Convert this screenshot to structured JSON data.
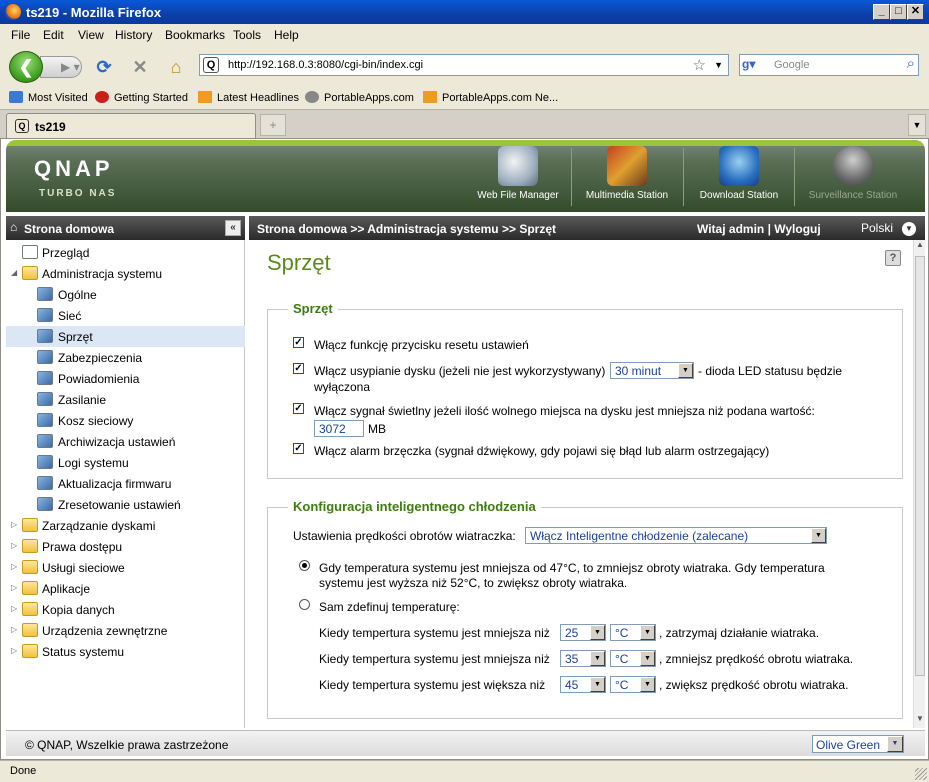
{
  "window": {
    "title": "ts219 - Mozilla Firefox"
  },
  "menu": [
    "File",
    "Edit",
    "View",
    "History",
    "Bookmarks",
    "Tools",
    "Help"
  ],
  "nav": {
    "url": "http://192.168.0.3:8080/cgi-bin/index.cgi",
    "search_placeholder": "Google"
  },
  "bookmarks": [
    "Most Visited",
    "Getting Started",
    "Latest Headlines",
    "PortableApps.com",
    "PortableApps.com Ne..."
  ],
  "tabs": {
    "active": "ts219",
    "new_tab_glyph": "+"
  },
  "header": {
    "logo": "QNAP",
    "sublogo": "TURBO NAS",
    "apps": [
      {
        "label": "Web File Manager"
      },
      {
        "label": "Multimedia Station"
      },
      {
        "label": "Download Station"
      },
      {
        "label": "Surveillance Station"
      }
    ]
  },
  "leftbar": {
    "title": "Strona domowa",
    "collapse": "«"
  },
  "rightbar": {
    "breadcrumb": "Strona domowa >> Administracja systemu >> Sprzęt",
    "welcome": "Witaj admin | Wyloguj",
    "language": "Polski"
  },
  "sidebar": {
    "items": [
      {
        "label": "Przegląd",
        "level": 0,
        "type": "page"
      },
      {
        "label": "Administracja systemu",
        "level": 0,
        "type": "folder",
        "expanded": true
      },
      {
        "label": "Ogólne",
        "level": 1
      },
      {
        "label": "Sieć",
        "level": 1
      },
      {
        "label": "Sprzęt",
        "level": 1,
        "selected": true
      },
      {
        "label": "Zabezpieczenia",
        "level": 1
      },
      {
        "label": "Powiadomienia",
        "level": 1
      },
      {
        "label": "Zasilanie",
        "level": 1
      },
      {
        "label": "Kosz sieciowy",
        "level": 1
      },
      {
        "label": "Archiwizacja ustawień",
        "level": 1
      },
      {
        "label": "Logi systemu",
        "level": 1
      },
      {
        "label": "Aktualizacja firmwaru",
        "level": 1
      },
      {
        "label": "Zresetowanie ustawień",
        "level": 1
      },
      {
        "label": "Zarządzanie dyskami",
        "level": 0,
        "type": "folder"
      },
      {
        "label": "Prawa dostępu",
        "level": 0,
        "type": "folder"
      },
      {
        "label": "Usługi sieciowe",
        "level": 0,
        "type": "folder"
      },
      {
        "label": "Aplikacje",
        "level": 0,
        "type": "folder"
      },
      {
        "label": "Kopia danych",
        "level": 0,
        "type": "folder"
      },
      {
        "label": "Urządzenia zewnętrzne",
        "level": 0,
        "type": "folder"
      },
      {
        "label": "Status systemu",
        "level": 0,
        "type": "folder"
      }
    ]
  },
  "main": {
    "title": "Sprzęt",
    "help": "?",
    "hardware": {
      "legend": "Sprzęt",
      "opt1": "Włącz funkcję przycisku resetu ustawień",
      "opt2_a": "Włącz usypianie dysku (jeżeli nie jest wykorzystywany)",
      "opt2_select": "30 minut",
      "opt2_b": "- dioda LED statusu będzie",
      "opt2_c": "wyłączona",
      "opt3": "Włącz sygnał świetlny jeżeli ilość wolnego miejsca na dysku jest mniejsza niż podana wartość:",
      "opt3_value": "3072",
      "opt3_unit": "MB",
      "opt4": "Włącz alarm brzęczka (sygnał dźwiękowy, gdy pojawi się błąd lub alarm ostrzegający)"
    },
    "cooling": {
      "legend": "Konfiguracja inteligentnego chłodzenia",
      "fan_label": "Ustawienia prędkości obrotów wiatraczka:",
      "fan_select": "Włącz Inteligentne chłodzenie (zalecane)",
      "radio1_a": "Gdy temperatura systemu jest mniejsza od 47°C, to zmniejsz obroty wiatraka. Gdy temperatura",
      "radio1_b": "systemu jest wyższa niż 52°C, to zwiększ obroty wiatraka.",
      "radio2": "Sam zdefinuj temperaturę:",
      "rows": [
        {
          "label": "Kiedy tempertura systemu jest mniejsza niż",
          "value": "25",
          "unit": "°C",
          "action": ", zatrzymaj działanie wiatraka."
        },
        {
          "label": "Kiedy tempertura systemu jest mniejsza niż",
          "value": "35",
          "unit": "°C",
          "action": ", zmniejsz prędkość obrotu wiatraka."
        },
        {
          "label": "Kiedy tempertura systemu jest większa niż",
          "value": "45",
          "unit": "°C",
          "action": ", zwiększ prędkość obrotu wiatraka."
        }
      ]
    }
  },
  "footer": {
    "copyright": "© QNAP, Wszelkie prawa zastrzeżone",
    "theme": "Olive Green"
  },
  "status": {
    "text": "Done"
  }
}
